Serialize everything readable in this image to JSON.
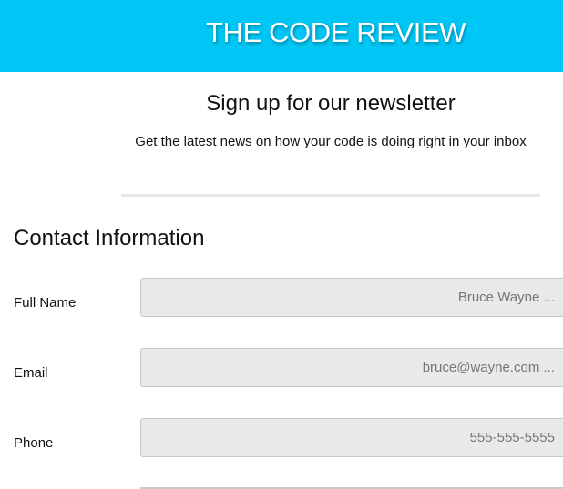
{
  "header": {
    "title": "THE CODE REVIEW",
    "background_color": "#00c6f5"
  },
  "newsletter": {
    "title": "Sign up for our newsletter",
    "subtitle": "Get the latest news on how your code is doing right in your inbox"
  },
  "contact": {
    "section_title": "Contact Information",
    "fields": [
      {
        "label": "Full Name",
        "placeholder": "Bruce Wayne ..."
      },
      {
        "label": "Email",
        "placeholder": "bruce@wayne.com ..."
      },
      {
        "label": "Phone",
        "placeholder": "555-555-5555"
      }
    ]
  }
}
